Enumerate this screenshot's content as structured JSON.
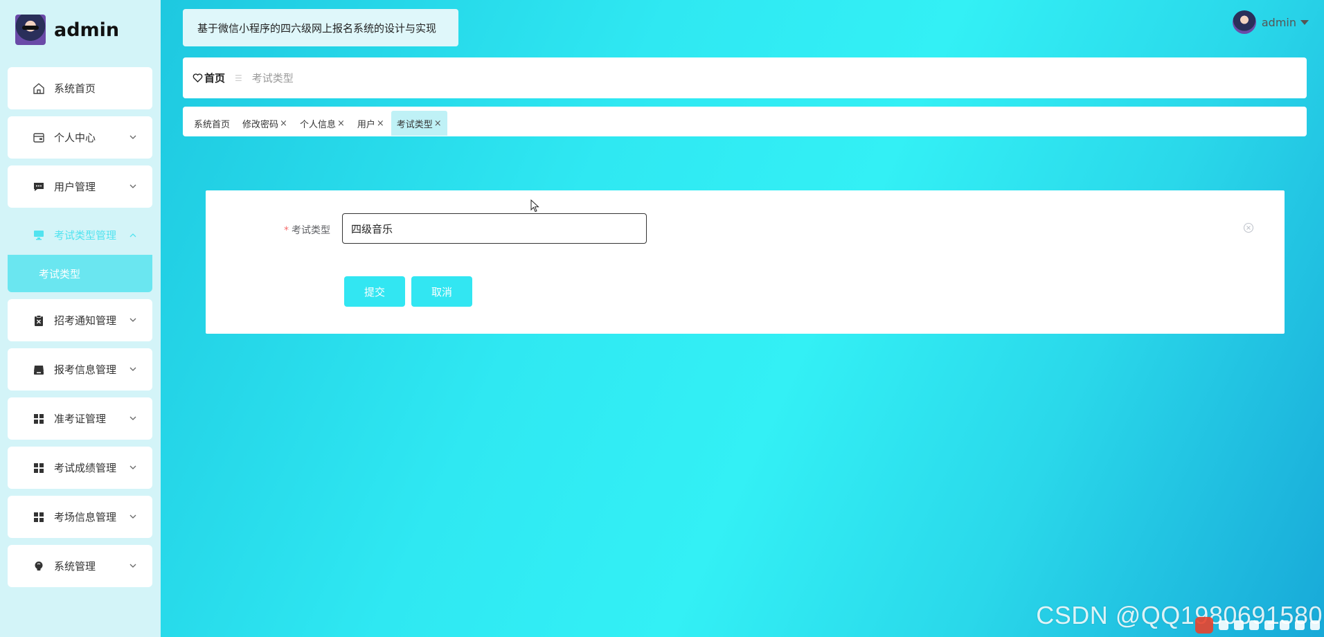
{
  "brand": {
    "name": "admin"
  },
  "sidebar": {
    "items": [
      {
        "label": "系统首页",
        "icon": "home-icon",
        "arrow": false
      },
      {
        "label": "个人中心",
        "icon": "wallet-icon",
        "arrow": true
      },
      {
        "label": "用户管理",
        "icon": "chat-icon",
        "arrow": true
      },
      {
        "label": "考试类型管理",
        "icon": "monitor-icon",
        "arrow": true,
        "active": true,
        "sub": "考试类型"
      },
      {
        "label": "招考通知管理",
        "icon": "clipboard-x-icon",
        "arrow": true
      },
      {
        "label": "报考信息管理",
        "icon": "tray-icon",
        "arrow": true
      },
      {
        "label": "准考证管理",
        "icon": "grid-icon",
        "arrow": true
      },
      {
        "label": "考试成绩管理",
        "icon": "grid-icon",
        "arrow": true
      },
      {
        "label": "考场信息管理",
        "icon": "grid-icon",
        "arrow": true
      },
      {
        "label": "系统管理",
        "icon": "bulb-icon",
        "arrow": true
      }
    ]
  },
  "header": {
    "title": "基于微信小程序的四六级网上报名系统的设计与实现",
    "user_name": "admin"
  },
  "breadcrumb": {
    "home": "首页",
    "separator": "☰",
    "current": "考试类型"
  },
  "tabs": [
    {
      "label": "系统首页",
      "closable": false
    },
    {
      "label": "修改密码",
      "closable": true
    },
    {
      "label": "个人信息",
      "closable": true
    },
    {
      "label": "用户",
      "closable": true
    },
    {
      "label": "考试类型",
      "closable": true,
      "active": true
    }
  ],
  "tab_close_glyph": "×",
  "form": {
    "required_mark": "*",
    "label": "考试类型",
    "value": "四级音乐",
    "submit": "提交",
    "cancel": "取消"
  },
  "watermark": "CSDN @QQ1980691580",
  "colors": {
    "accent": "#32e6f2",
    "active_text": "#51e3ef",
    "submenu_bg": "#6ae6f0"
  }
}
